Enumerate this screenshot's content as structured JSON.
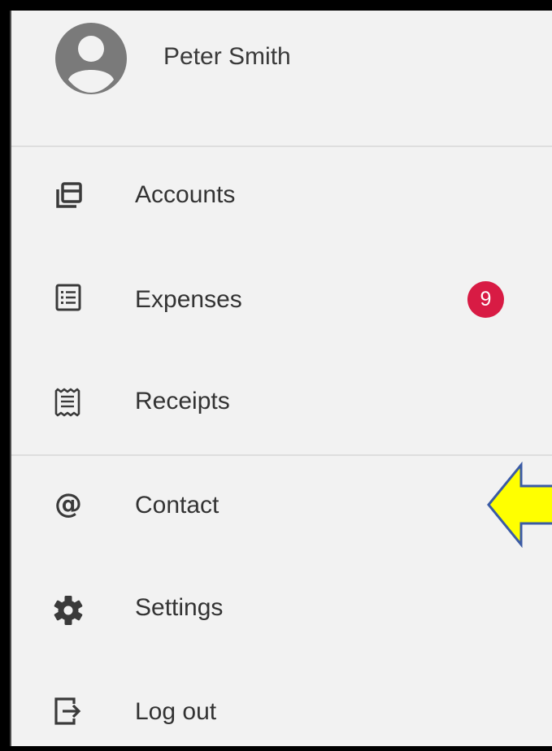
{
  "user": {
    "name": "Peter Smith",
    "avatar_icon": "account-circle-icon"
  },
  "menu": {
    "items": [
      {
        "label": "Accounts",
        "icon": "accounts-icon"
      },
      {
        "label": "Expenses",
        "icon": "list-icon",
        "badge": "9"
      },
      {
        "label": "Receipts",
        "icon": "receipt-icon"
      },
      {
        "label": "Contact",
        "icon": "at-sign-icon"
      },
      {
        "label": "Settings",
        "icon": "gear-icon"
      },
      {
        "label": "Log out",
        "icon": "logout-icon"
      }
    ]
  },
  "colors": {
    "background": "#f2f2f2",
    "badge": "#d81b44",
    "annotation_arrow": "#ffff00",
    "annotation_border": "#3b5ba5"
  },
  "annotation": {
    "type": "arrow",
    "points_to": "Contact"
  }
}
